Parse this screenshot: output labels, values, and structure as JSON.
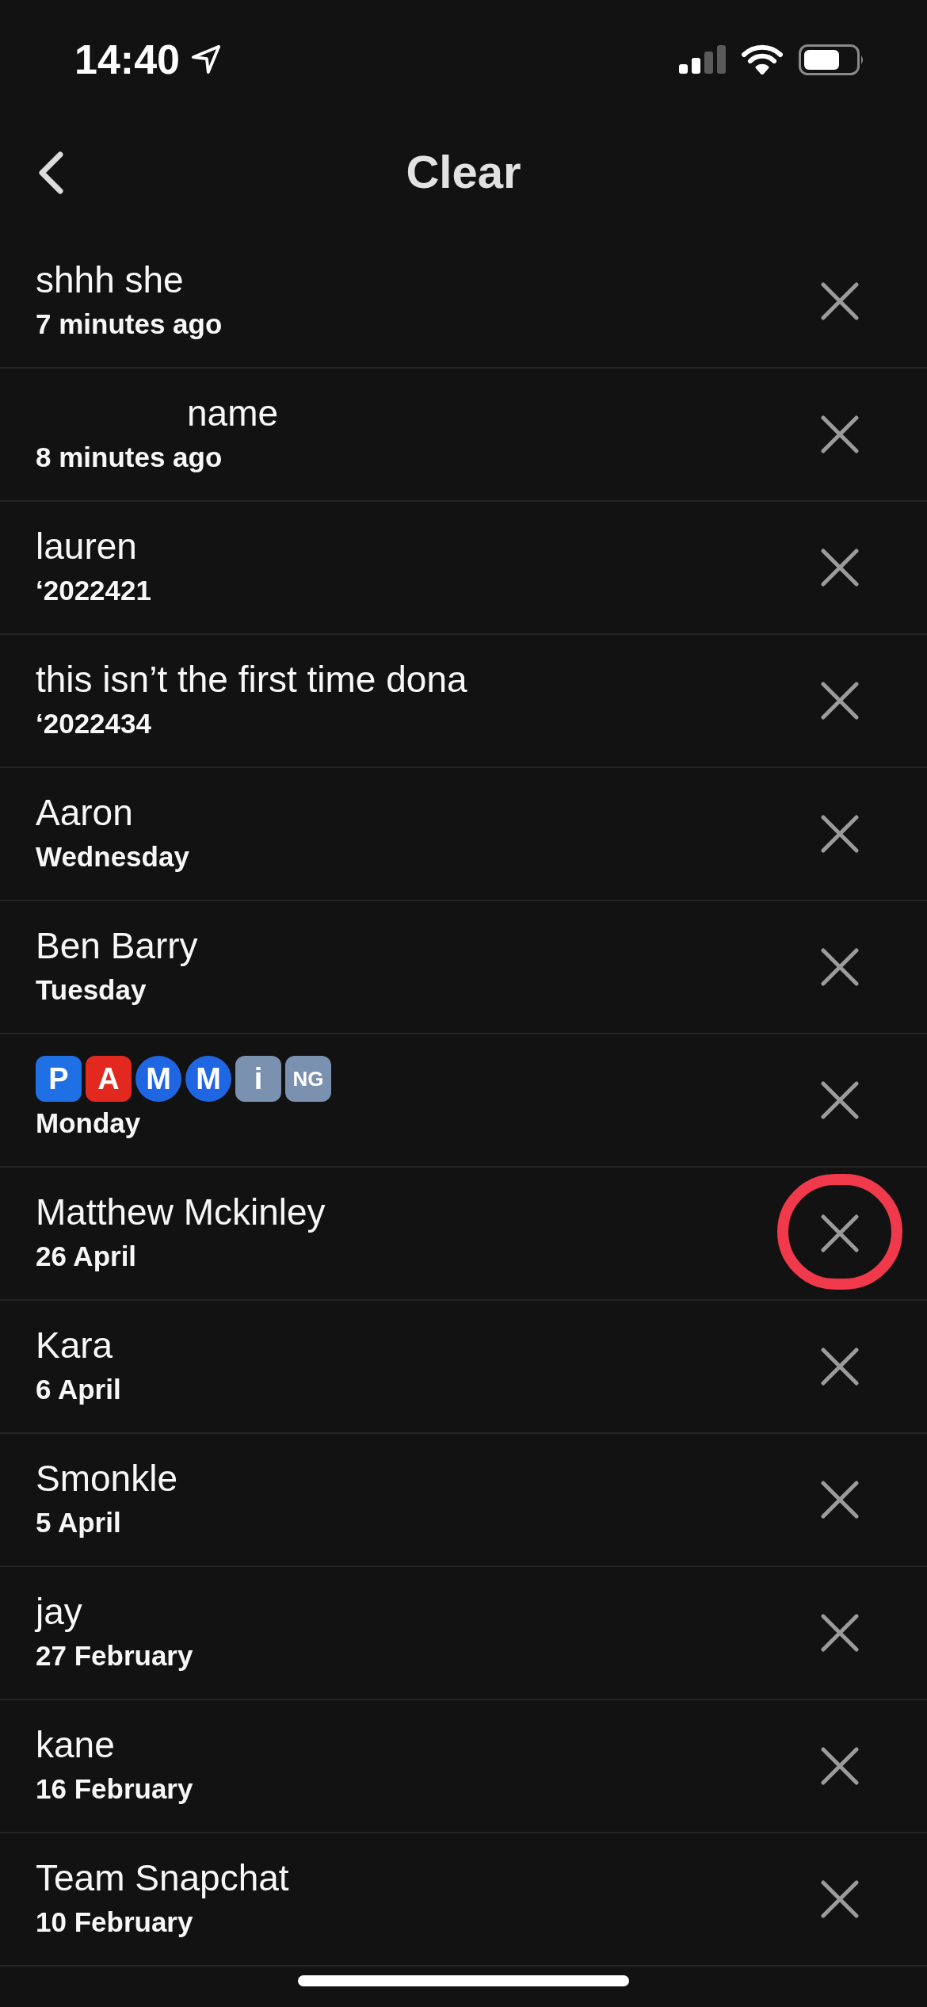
{
  "status_bar": {
    "time": "14:40"
  },
  "nav": {
    "title": "Clear"
  },
  "rows": [
    {
      "kind": "text",
      "name": "shhh she",
      "subtitle": "7 minutes ago",
      "circled": false
    },
    {
      "kind": "text",
      "name": "name",
      "redacted": true,
      "subtitle": "8 minutes ago",
      "circled": false
    },
    {
      "kind": "text",
      "name": "lauren",
      "subtitle": "‘2022421",
      "circled": false
    },
    {
      "kind": "text",
      "name": "this isn’t the first time dona",
      "subtitle": "‘2022434",
      "circled": false
    },
    {
      "kind": "text",
      "name": "Aaron",
      "subtitle": "Wednesday",
      "circled": false
    },
    {
      "kind": "text",
      "name": "Ben Barry",
      "subtitle": "Tuesday",
      "circled": false
    },
    {
      "kind": "tiles",
      "name_tiles": [
        {
          "text": "P",
          "kind": "square",
          "color": "#1f6fe5"
        },
        {
          "text": "A",
          "kind": "square",
          "color": "#e3281f"
        },
        {
          "text": "M",
          "kind": "circle",
          "color": "#1f66e3"
        },
        {
          "text": "M",
          "kind": "circle",
          "color": "#1f66e3"
        },
        {
          "text": "i",
          "kind": "square",
          "color": "#7b91b0"
        },
        {
          "text": "NG",
          "kind": "square",
          "color": "#7b91b0"
        }
      ],
      "subtitle": "Monday",
      "circled": false
    },
    {
      "kind": "text",
      "name": "Matthew Mckinley",
      "subtitle": "26 April",
      "circled": true
    },
    {
      "kind": "text",
      "name": "Kara",
      "subtitle": "6 April",
      "circled": false
    },
    {
      "kind": "text",
      "name": "Smonkle",
      "subtitle": "5 April",
      "circled": false
    },
    {
      "kind": "text",
      "name": "jay",
      "subtitle": "27 February",
      "circled": false
    },
    {
      "kind": "text",
      "name": "kane",
      "subtitle": "16 February",
      "circled": false
    },
    {
      "kind": "text",
      "name": "Team Snapchat",
      "subtitle": "10 February",
      "circled": false
    }
  ]
}
